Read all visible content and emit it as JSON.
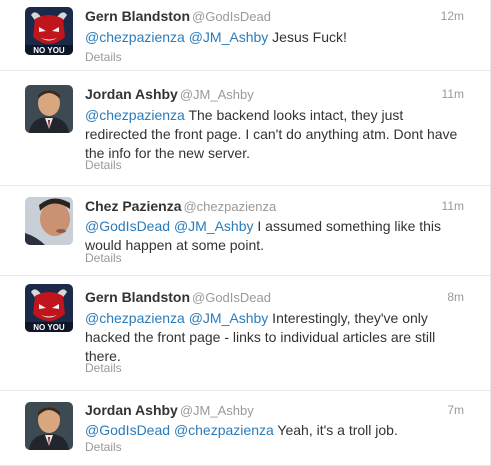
{
  "tweets": [
    {
      "fullname": "Gern Blandston",
      "username": "@GodIsDead",
      "time": "12m",
      "mentions": [
        "@chezpazienza",
        "@JM_Ashby"
      ],
      "text": " Jesus Fuck!",
      "details": "Details",
      "avatar": "devil-avatar"
    },
    {
      "fullname": "Jordan Ashby",
      "username": "@JM_Ashby",
      "time": "11m",
      "mentions": [
        "@chezpazienza"
      ],
      "text": " The backend looks intact, they just redirected the front page. I can't do anything atm. Dont have the info for the new server.",
      "details": "Details",
      "avatar": "man-portrait-avatar"
    },
    {
      "fullname": "Chez Pazienza",
      "username": "@chezpazienza",
      "time": "11m",
      "mentions": [
        "@GodIsDead",
        "@JM_Ashby"
      ],
      "text": " I assumed something like this would happen at some point.",
      "details": "Details",
      "avatar": "man-profile-avatar"
    },
    {
      "fullname": "Gern Blandston",
      "username": "@GodIsDead",
      "time": "8m",
      "mentions": [
        "@chezpazienza",
        "@JM_Ashby"
      ],
      "text": " Interestingly, they've only hacked the front page - links to individual articles are still there.",
      "details": "Details",
      "avatar": "devil-avatar"
    },
    {
      "fullname": "Jordan Ashby",
      "username": "@JM_Ashby",
      "time": "7m",
      "mentions": [
        "@GodIsDead",
        "@chezpazienza"
      ],
      "text": " Yeah, it's a troll job.",
      "details": "Details",
      "avatar": "man-portrait-avatar"
    }
  ],
  "colors": {
    "link": "#2b7bb9",
    "meta": "#999999",
    "text": "#333333",
    "divider": "#e8e8e8"
  }
}
